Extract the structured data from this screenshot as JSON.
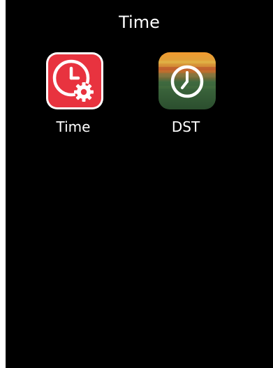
{
  "screen": {
    "title": "Time"
  },
  "apps": [
    {
      "label": "Time",
      "icon": "clock-gear-icon",
      "color": "#e8333f"
    },
    {
      "label": "DST",
      "icon": "clock-icon",
      "gradient": [
        "#f29a2e",
        "#d8a33d",
        "#c86f2d",
        "#3f6a3f",
        "#2b4e2e"
      ]
    }
  ]
}
